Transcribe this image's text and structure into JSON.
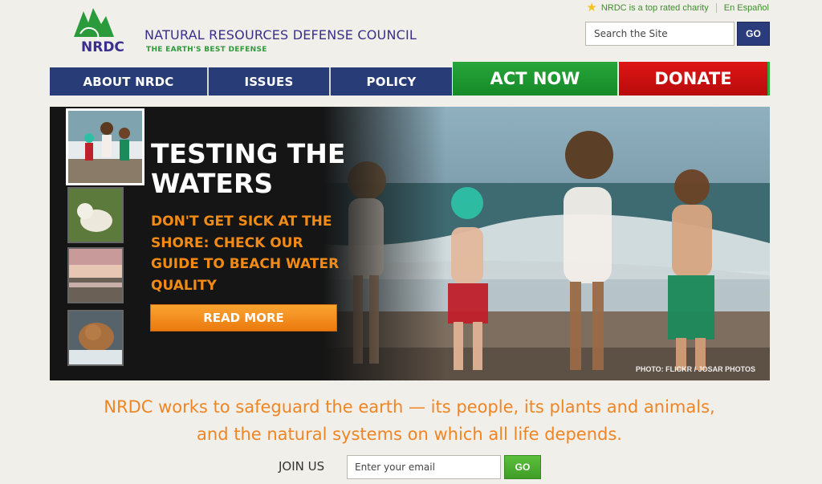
{
  "header": {
    "logo_text": "NRDC",
    "org_name": "NATURAL RESOURCES DEFENSE COUNCIL",
    "tagline": "THE EARTH'S BEST DEFENSE",
    "charity_note": "NRDC is a top rated charity",
    "language_link": "En Español",
    "search": {
      "placeholder": "Search the Site",
      "button": "GO"
    }
  },
  "nav": {
    "items": [
      {
        "label": "ABOUT NRDC"
      },
      {
        "label": "ISSUES"
      },
      {
        "label": "POLICY"
      }
    ],
    "act_now": "ACT NOW",
    "donate": "DONATE"
  },
  "hero": {
    "title": "TESTING THE WATERS",
    "subtitle": "DON'T GET SICK AT THE SHORE: CHECK OUR GUIDE TO BEACH WATER QUALITY",
    "cta": "READ MORE",
    "photo_credit": "PHOTO: FLICKR / JOSAR PHOTOS",
    "thumbnails": [
      "children-beach",
      "spirit-bear",
      "sunset-wetland",
      "grizzly-bear-salmon"
    ]
  },
  "mission": "NRDC works to safeguard the earth — its people, its plants and animals, and the natural systems on which all life depends.",
  "join": {
    "label": "JOIN US",
    "placeholder": "Enter your email",
    "button": "GO"
  },
  "colors": {
    "nav_blue": "#283c78",
    "act_green": "#1e9a32",
    "donate_red": "#cc1010",
    "accent_orange": "#f08524",
    "brand_green": "#2f9a3a",
    "brand_purple": "#3a2f8c"
  }
}
